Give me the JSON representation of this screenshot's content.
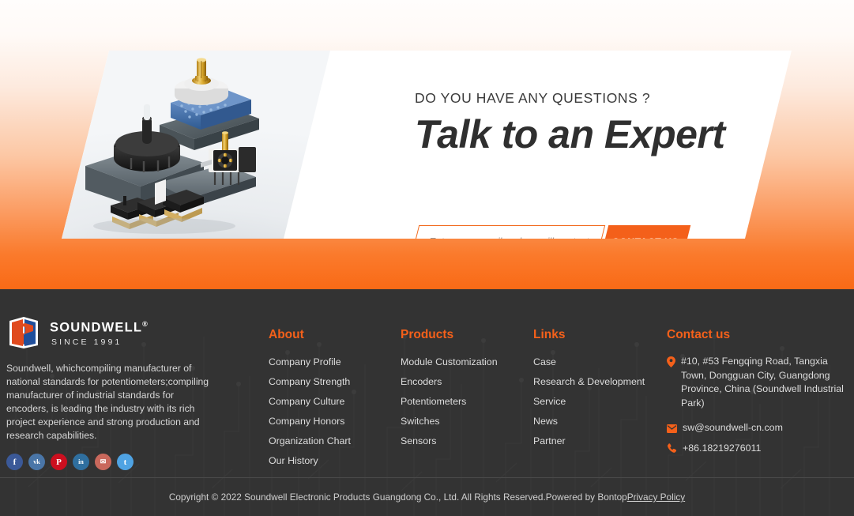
{
  "cta": {
    "eyebrow": "DO YOU HAVE ANY QUESTIONS ?",
    "title": "Talk to an Expert",
    "email_placeholder": "Enter your email and we will contact you",
    "email_value": "",
    "button_label": "CONTACT US",
    "accent_color": "#f4601a",
    "photo_alt": "rotary switches, encoders and potentiometers product photo"
  },
  "footer": {
    "brand": {
      "name": "SOUNDWELL",
      "registered_mark": "®",
      "since": "SINCE 1991",
      "description": "Soundwell, whichcompiling manufacturer of national standards for potentiometers;compiling manufacturer of industrial standards for encoders, is leading the industry with its rich project experience and strong production and research capabilities.",
      "socials": [
        {
          "name": "facebook",
          "glyph": "f",
          "color": "#3b5998"
        },
        {
          "name": "vk",
          "glyph": "vk",
          "color": "#4a76a8"
        },
        {
          "name": "pinterest",
          "glyph": "P",
          "color": "#cc0f1f"
        },
        {
          "name": "linkedin",
          "glyph": "in",
          "color": "#2f6f9f"
        },
        {
          "name": "email",
          "glyph": "✉",
          "color": "#c9685c"
        },
        {
          "name": "twitter",
          "glyph": "t",
          "color": "#4fa3e3"
        }
      ]
    },
    "columns": [
      {
        "title": "About",
        "items": [
          "Company Profile",
          "Company Strength",
          "Company Culture",
          "Company Honors",
          "Organization Chart",
          "Our History"
        ]
      },
      {
        "title": "Products",
        "items": [
          "Module Customization",
          "Encoders",
          "Potentiometers",
          "Switches",
          "Sensors"
        ]
      },
      {
        "title": "Links",
        "items": [
          "Case",
          "Research & Development",
          "Service",
          "News",
          "Partner"
        ]
      }
    ],
    "contact": {
      "title": "Contact us",
      "address": "#10, #53 Fengqing Road, Tangxia Town, Dongguan City, Guangdong Province, China (Soundwell Industrial Park)",
      "email": "sw@soundwell-cn.com",
      "phone": "+86.18219276011"
    },
    "copyright": "Copyright © 2022 Soundwell Electronic Products Guangdong Co., Ltd. All Rights Reserved.",
    "powered_by": "Powered by Bontop",
    "privacy_policy": "Privacy Policy"
  },
  "theme": {
    "orange": "#f4601a",
    "footer_bg": "#333333",
    "heading_dark": "#2f2f2f"
  }
}
